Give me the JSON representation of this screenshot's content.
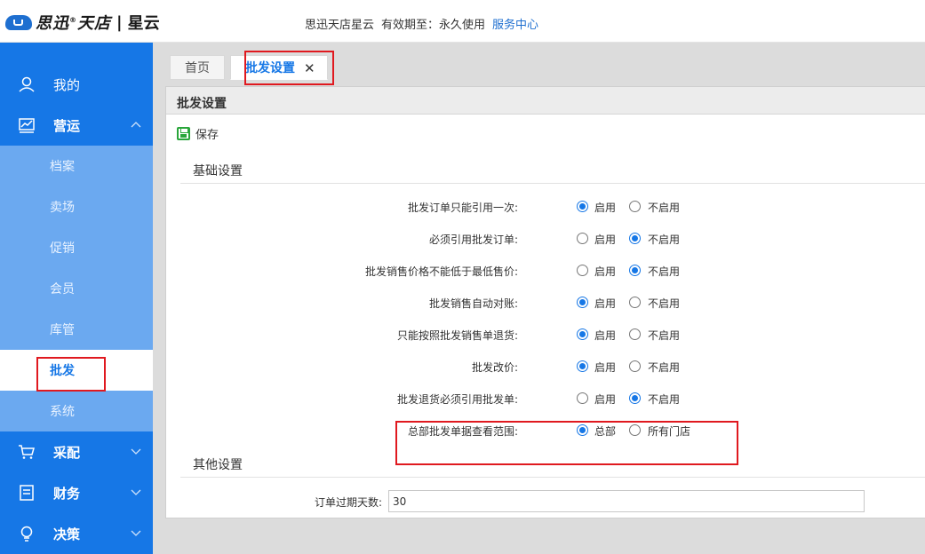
{
  "brand": {
    "name": "思迅",
    "sub1": "天店",
    "separator": "|",
    "sub2": "星云",
    "reg": "®"
  },
  "top_info": {
    "product": "思迅天店星云",
    "validity_label": "有效期至：",
    "validity_value": "永久使用",
    "service_link": "服务中心"
  },
  "sidebar": {
    "items": [
      {
        "label": "我的",
        "icon": "user-icon"
      },
      {
        "label": "营运",
        "icon": "chart-icon",
        "expanded": true
      },
      {
        "label": "采配",
        "icon": "cart-icon"
      },
      {
        "label": "财务",
        "icon": "finance-icon"
      },
      {
        "label": "决策",
        "icon": "bulb-icon"
      }
    ],
    "sub_items": [
      {
        "label": "档案"
      },
      {
        "label": "卖场"
      },
      {
        "label": "促销"
      },
      {
        "label": "会员"
      },
      {
        "label": "库管"
      },
      {
        "label": "批发",
        "active": true
      },
      {
        "label": "系统"
      }
    ]
  },
  "tabs": {
    "home": "首页",
    "active": "批发设置",
    "close": "✕"
  },
  "panel": {
    "title": "批发设置",
    "save_label": "保存",
    "section_basic": "基础设置",
    "section_other": "其他设置",
    "settings": [
      {
        "label": "批发订单只能引用一次:",
        "opt1": "启用",
        "opt2": "不启用",
        "selected": 1
      },
      {
        "label": "必须引用批发订单:",
        "opt1": "启用",
        "opt2": "不启用",
        "selected": 2
      },
      {
        "label": "批发销售价格不能低于最低售价:",
        "opt1": "启用",
        "opt2": "不启用",
        "selected": 2
      },
      {
        "label": "批发销售自动对账:",
        "opt1": "启用",
        "opt2": "不启用",
        "selected": 1
      },
      {
        "label": "只能按照批发销售单退货:",
        "opt1": "启用",
        "opt2": "不启用",
        "selected": 1
      },
      {
        "label": "批发改价:",
        "opt1": "启用",
        "opt2": "不启用",
        "selected": 1
      },
      {
        "label": "批发退货必须引用批发单:",
        "opt1": "启用",
        "opt2": "不启用",
        "selected": 2
      },
      {
        "label": "总部批发单据查看范围:",
        "opt1": "总部",
        "opt2": "所有门店",
        "selected": 1
      }
    ],
    "order_expiry_label": "订单过期天数:",
    "order_expiry_value": "30"
  },
  "colors": {
    "sidebar": "#1677e6",
    "submenu": "#6ba9f0",
    "accent": "#1677e6",
    "highlight_box": "#e0191f",
    "save_icon": "#2aa63b"
  }
}
